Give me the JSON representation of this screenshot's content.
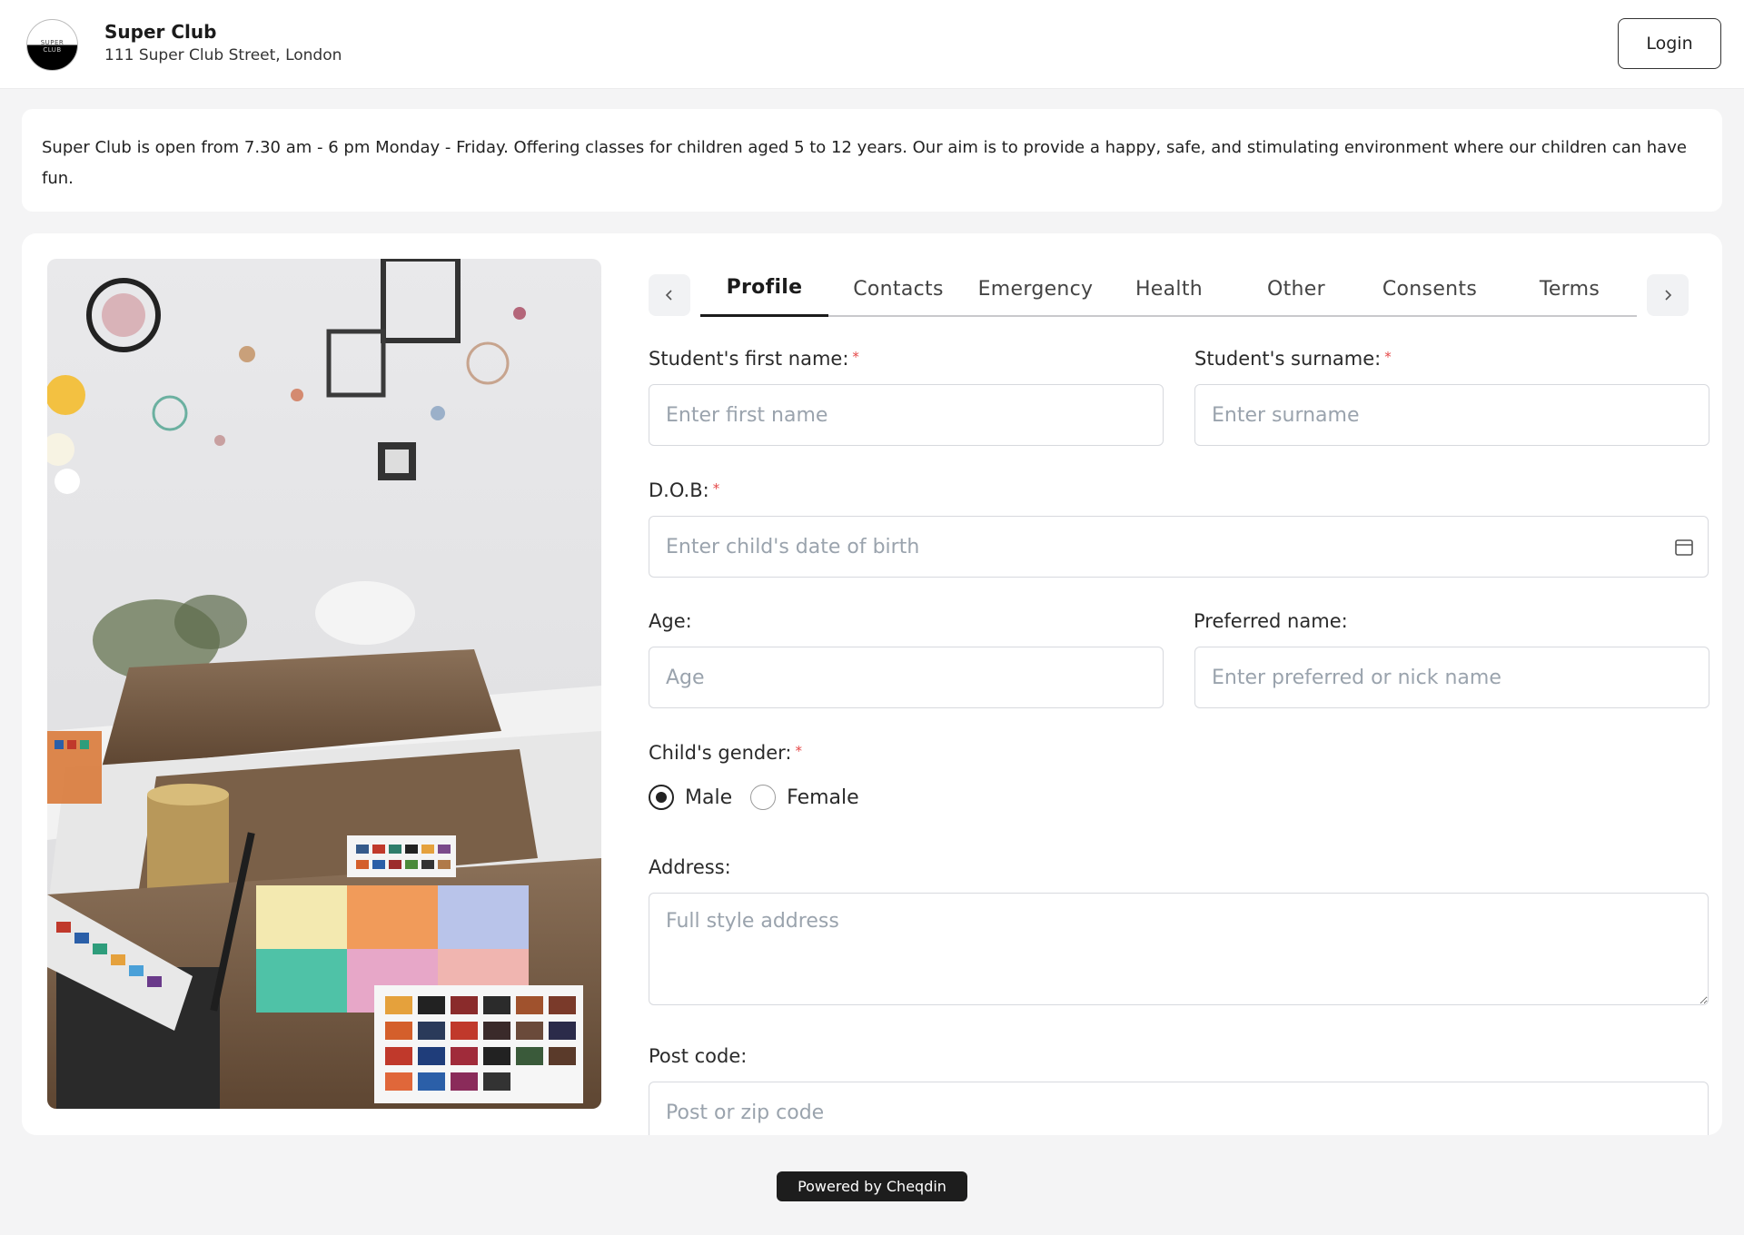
{
  "header": {
    "logo_top": "SUPER",
    "logo_bottom": "CLUB",
    "club_name": "Super Club",
    "club_address": "111 Super Club Street, London",
    "login_label": "Login"
  },
  "info": {
    "text": "Super Club is open from 7.30 am - 6 pm Monday - Friday. Offering classes for children aged 5 to 12 years. Our aim is to provide a happy, safe, and stimulating environment where our children can have fun."
  },
  "tabs": [
    {
      "label": "Profile",
      "active": true
    },
    {
      "label": "Contacts"
    },
    {
      "label": "Emergency"
    },
    {
      "label": "Health"
    },
    {
      "label": "Other"
    },
    {
      "label": "Consents"
    },
    {
      "label": "Terms"
    }
  ],
  "form": {
    "first_name": {
      "label": "Student's first name:",
      "required_mark": "*",
      "placeholder": "Enter first name",
      "value": ""
    },
    "surname": {
      "label": "Student's surname:",
      "required_mark": "*",
      "placeholder": "Enter surname",
      "value": ""
    },
    "dob": {
      "label": "D.O.B:",
      "required_mark": "*",
      "placeholder": "Enter child's date of birth",
      "value": ""
    },
    "age": {
      "label": "Age:",
      "placeholder": "Age",
      "value": ""
    },
    "preferred_name": {
      "label": "Preferred name:",
      "placeholder": "Enter preferred or nick name",
      "value": ""
    },
    "gender": {
      "label": "Child's gender:",
      "required_mark": "*",
      "options": [
        "Male",
        "Female"
      ],
      "selected": "Male"
    },
    "address": {
      "label": "Address:",
      "placeholder": "Full style address",
      "value": ""
    },
    "postcode": {
      "label": "Post code:",
      "placeholder": "Post or zip code",
      "value": ""
    }
  },
  "footer": {
    "powered_by": "Powered by Cheqdin"
  },
  "colors": {
    "required": "#e54848",
    "page_bg": "#f4f4f5",
    "footer_badge": "#1d1d1d"
  }
}
